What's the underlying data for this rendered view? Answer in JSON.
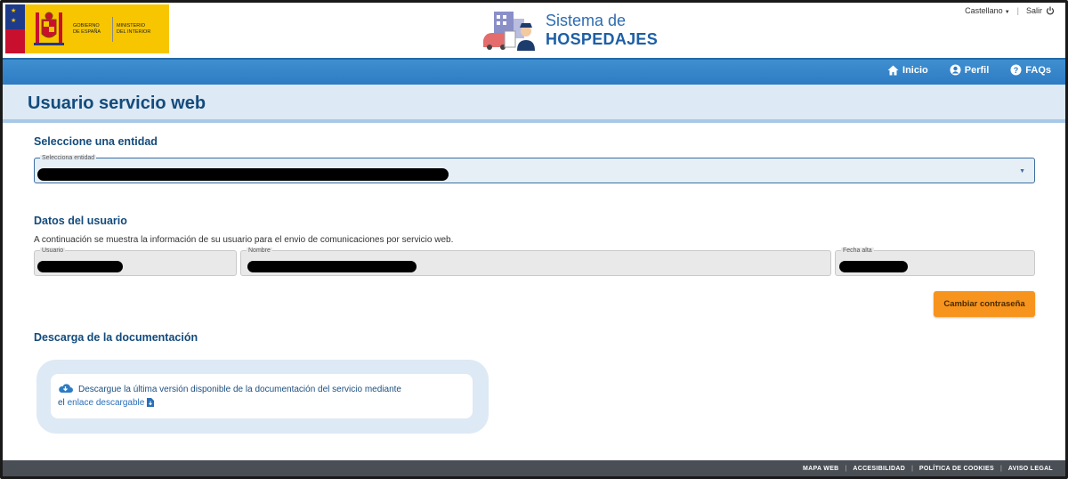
{
  "header": {
    "gov_line1": "GOBIERNO",
    "gov_line2": "DE ESPAÑA",
    "ministry_line1": "MINISTERIO",
    "ministry_line2": "DEL INTERIOR",
    "brand_line1": "Sistema de",
    "brand_line2": "HOSPEDAJES",
    "language": "Castellano",
    "logout": "Salir"
  },
  "nav": {
    "items": [
      {
        "label": "Inicio",
        "icon": "home-icon"
      },
      {
        "label": "Perfil",
        "icon": "user-icon"
      },
      {
        "label": "FAQs",
        "icon": "question-icon"
      }
    ]
  },
  "page": {
    "title": "Usuario servicio web"
  },
  "entity": {
    "section_title": "Seleccione una entidad",
    "label": "Selecciona entidad",
    "value": "[redacted]"
  },
  "user": {
    "section_title": "Datos del usuario",
    "description": "A continuación se muestra la información de su usuario para el envio de comunicaciones por servicio web.",
    "fields": [
      {
        "label": "Usuario",
        "value": "[redacted]"
      },
      {
        "label": "Nombre",
        "value": "[redacted]"
      },
      {
        "label": "Fecha alta",
        "value": "[redacted]"
      }
    ],
    "change_password": "Cambiar contraseña"
  },
  "docs": {
    "section_title": "Descarga de la documentación",
    "text": "Descargue la última versión disponible de la documentación del servicio mediante",
    "prefix": "el",
    "link": "enlace descargable"
  },
  "footer": {
    "links": [
      "MAPA WEB",
      "ACCESIBILIDAD",
      "POLÍTICA DE COOKIES",
      "AVISO LEGAL"
    ]
  },
  "colors": {
    "nav_blue": "#2e7bc3",
    "title_navy": "#134b7c",
    "button_orange": "#f7941d",
    "footer_grey": "#4a4e55"
  }
}
